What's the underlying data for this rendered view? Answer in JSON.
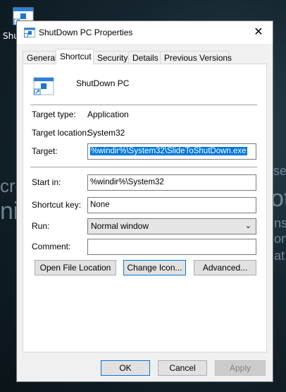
{
  "desktop": {
    "icon_label": "Shu",
    "bg_fragments": [
      "se",
      "cro",
      "ot",
      "nsi",
      "ni",
      "on",
      "at"
    ]
  },
  "window": {
    "title": "ShutDown PC Properties",
    "close_glyph": "✕"
  },
  "tabs": [
    {
      "label": "General"
    },
    {
      "label": "Shortcut"
    },
    {
      "label": "Security"
    },
    {
      "label": "Details"
    },
    {
      "label": "Previous Versions"
    }
  ],
  "shortcut": {
    "name": "ShutDown PC",
    "target_type_label": "Target type:",
    "target_type_value": "Application",
    "target_location_label": "Target location:",
    "target_location_value": "System32",
    "target_label": "Target:",
    "target_value": "%windir%\\System32\\SlideToShutDown.exe",
    "start_in_label": "Start in:",
    "start_in_value": "%windir%\\System32",
    "shortcut_key_label": "Shortcut key:",
    "shortcut_key_value": "None",
    "run_label": "Run:",
    "run_value": "Normal window",
    "comment_label": "Comment:",
    "comment_value": ""
  },
  "buttons": {
    "open_file_location": "Open File Location",
    "change_icon": "Change Icon...",
    "advanced": "Advanced...",
    "ok": "OK",
    "cancel": "Cancel",
    "apply": "Apply"
  },
  "colors": {
    "selection": "#0078d7",
    "focus_border": "#0078d7"
  }
}
